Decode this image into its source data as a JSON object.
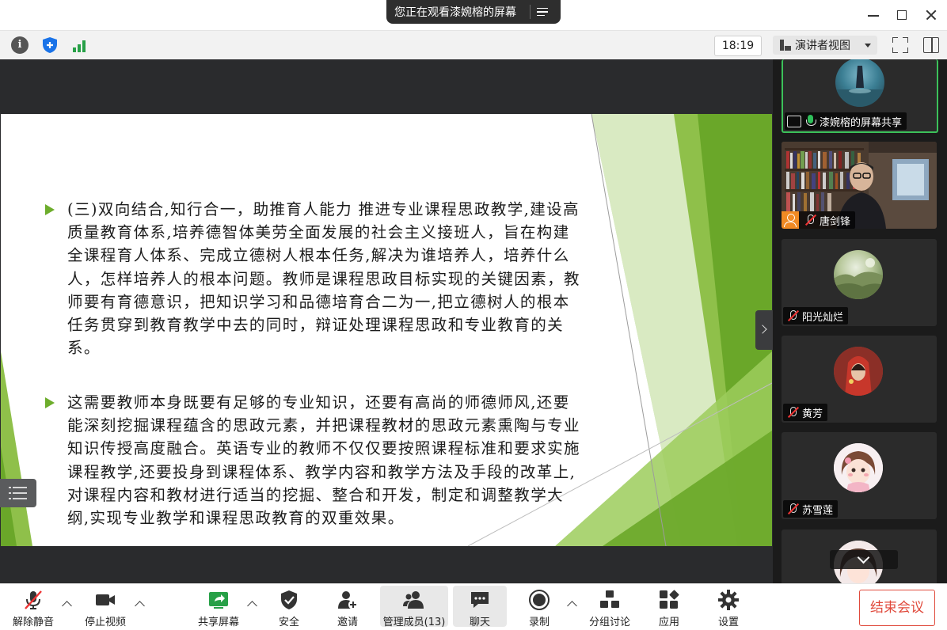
{
  "banner": {
    "text": "您正在观看漆婉榕的屏幕"
  },
  "toolbar": {
    "clock": "18:19",
    "view_mode": "演讲者视图"
  },
  "slide": {
    "paragraphs": [
      {
        "text": "(三)双向结合,知行合一，助推育人能力 推进专业课程思政教学,建设高质量教育体系,培养德智体美劳全面发展的社会主义接班人，旨在构建全课程育人体系、完成立德树人根本任务,解决为谁培养人，培养什么人，怎样培养人的根本问题。教师是课程思政目标实现的关键因素，教师要有育德意识，把知识学习和品德培育合二为一,把立德树人的根本任务贯穿到教育教学中去的同时，辩证处理课程思政和专业教育的关系。"
      },
      {
        "text": "这需要教师本身既要有足够的专业知识，还要有高尚的师德师风,还要能深刻挖掘课程蕴含的思政元素，并把课程教材的思政元素熏陶与专业知识传授高度融合。英语专业的教师不仅仅要按照课程标准和要求实施课程教学,还要投身到课程体系、教学内容和教学方法及手段的改革上,对课程内容和教材进行适当的挖掘、整合和开发，制定和调整教学大纲,实现专业教学和课程思政教育的双重效果。"
      }
    ],
    "accent_color": "#6dad2c"
  },
  "participants": [
    {
      "name": "漆婉榕的屏幕共享",
      "mic": "on",
      "sharing": true
    },
    {
      "name": "唐剑锋",
      "mic": "off",
      "video": true
    },
    {
      "name": "阳光灿烂",
      "mic": "off"
    },
    {
      "name": "黄芳",
      "mic": "off"
    },
    {
      "name": "苏雪莲",
      "mic": "off"
    },
    {
      "name": "",
      "mic": "off"
    }
  ],
  "controls": {
    "unmute": "解除静音",
    "stop_video": "停止视频",
    "share_screen": "共享屏幕",
    "security": "安全",
    "invite": "邀请",
    "manage_participants": "管理成员(13)",
    "chat": "聊天",
    "record": "录制",
    "breakout": "分组讨论",
    "apps": "应用",
    "settings": "设置",
    "end_meeting": "结束会议"
  },
  "colors": {
    "share_green": "#27a047",
    "end_red": "#e04a3c",
    "active_speaker": "#3cc15a"
  }
}
